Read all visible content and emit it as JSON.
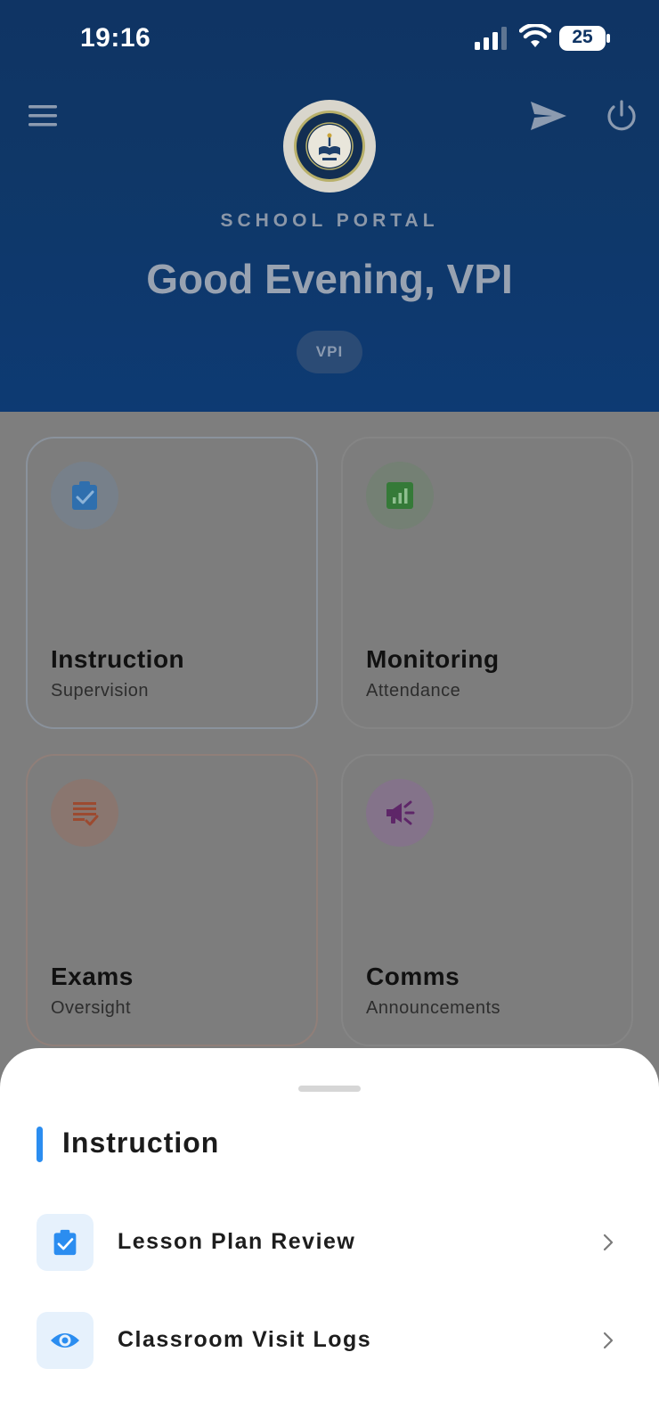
{
  "status_bar": {
    "time": "19:16",
    "battery_level": "25",
    "icons": [
      "cellular-signal-icon",
      "wifi-icon",
      "battery-icon"
    ]
  },
  "header": {
    "portal_label": "SCHOOL PORTAL",
    "greeting": "Good Evening, VPI",
    "role_badge": "VPI",
    "icons": [
      "menu-icon",
      "send-icon",
      "power-icon"
    ]
  },
  "cards": [
    {
      "title": "Instruction",
      "subtitle": "Supervision",
      "icon": "clipboard-check-icon",
      "accent": "#2f86d9"
    },
    {
      "title": "Monitoring",
      "subtitle": "Attendance",
      "icon": "bar-chart-icon",
      "accent": "#3f8f3f"
    },
    {
      "title": "Exams",
      "subtitle": "Oversight",
      "icon": "checklist-icon",
      "accent": "#c44f2c"
    },
    {
      "title": "Comms",
      "subtitle": "Announcements",
      "icon": "megaphone-icon",
      "accent": "#7f2d8f"
    }
  ],
  "sheet": {
    "title": "Instruction",
    "accent": "#2b8df0",
    "items": [
      {
        "label": "Lesson Plan Review",
        "icon": "clipboard-check-icon"
      },
      {
        "label": "Classroom Visit Logs",
        "icon": "eye-icon"
      }
    ]
  }
}
